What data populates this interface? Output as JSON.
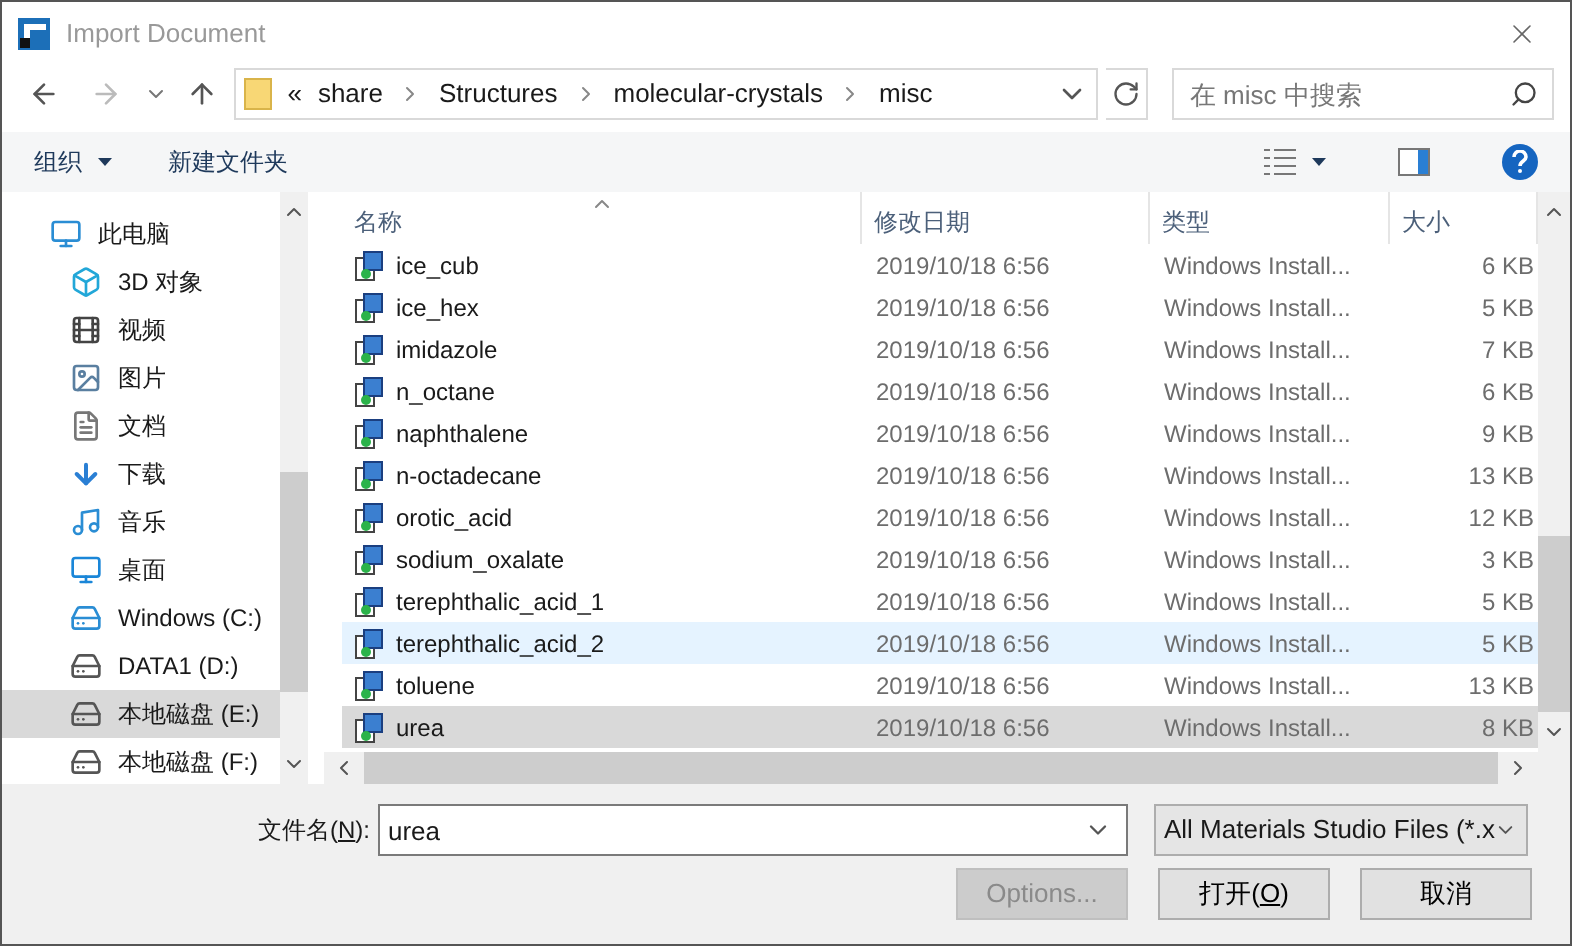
{
  "window": {
    "title": "Import Document"
  },
  "address_bar": {
    "overflow": "«",
    "segments": [
      "share",
      "Structures",
      "molecular-crystals",
      "misc"
    ]
  },
  "search": {
    "placeholder": "在 misc 中搜索"
  },
  "toolbar": {
    "organize": "组织",
    "new_folder": "新建文件夹"
  },
  "sidebar": {
    "items": [
      {
        "label": "此电脑",
        "kind": "computer",
        "selected": false,
        "children": [
          {
            "label": "3D 对象",
            "kind": "cube",
            "selected": false
          },
          {
            "label": "视频",
            "kind": "video",
            "selected": false
          },
          {
            "label": "图片",
            "kind": "pictures",
            "selected": false
          },
          {
            "label": "文档",
            "kind": "document",
            "selected": false
          },
          {
            "label": "下载",
            "kind": "download",
            "selected": false
          },
          {
            "label": "音乐",
            "kind": "music",
            "selected": false
          },
          {
            "label": "桌面",
            "kind": "desktop",
            "selected": false
          },
          {
            "label": "Windows (C:)",
            "kind": "system-drive",
            "selected": false
          },
          {
            "label": "DATA1 (D:)",
            "kind": "drive",
            "selected": false
          },
          {
            "label": "本地磁盘 (E:)",
            "kind": "drive",
            "selected": true
          },
          {
            "label": "本地磁盘 (F:)",
            "kind": "drive",
            "selected": false
          }
        ]
      }
    ]
  },
  "table": {
    "columns": [
      {
        "label": "名称",
        "sorted": true
      },
      {
        "label": "修改日期",
        "sorted": false
      },
      {
        "label": "类型",
        "sorted": false
      },
      {
        "label": "大小",
        "sorted": false
      }
    ],
    "rows": [
      {
        "name": "ice_cub",
        "modified": "2019/10/18 6:56",
        "type": "Windows Install...",
        "size": "6 KB",
        "selected": false,
        "hovered": false
      },
      {
        "name": "ice_hex",
        "modified": "2019/10/18 6:56",
        "type": "Windows Install...",
        "size": "5 KB",
        "selected": false,
        "hovered": false
      },
      {
        "name": "imidazole",
        "modified": "2019/10/18 6:56",
        "type": "Windows Install...",
        "size": "7 KB",
        "selected": false,
        "hovered": false
      },
      {
        "name": "n_octane",
        "modified": "2019/10/18 6:56",
        "type": "Windows Install...",
        "size": "6 KB",
        "selected": false,
        "hovered": false
      },
      {
        "name": "naphthalene",
        "modified": "2019/10/18 6:56",
        "type": "Windows Install...",
        "size": "9 KB",
        "selected": false,
        "hovered": false
      },
      {
        "name": "n-octadecane",
        "modified": "2019/10/18 6:56",
        "type": "Windows Install...",
        "size": "13 KB",
        "selected": false,
        "hovered": false
      },
      {
        "name": "orotic_acid",
        "modified": "2019/10/18 6:56",
        "type": "Windows Install...",
        "size": "12 KB",
        "selected": false,
        "hovered": false
      },
      {
        "name": "sodium_oxalate",
        "modified": "2019/10/18 6:56",
        "type": "Windows Install...",
        "size": "3 KB",
        "selected": false,
        "hovered": false
      },
      {
        "name": "terephthalic_acid_1",
        "modified": "2019/10/18 6:56",
        "type": "Windows Install...",
        "size": "5 KB",
        "selected": false,
        "hovered": false
      },
      {
        "name": "terephthalic_acid_2",
        "modified": "2019/10/18 6:56",
        "type": "Windows Install...",
        "size": "5 KB",
        "selected": false,
        "hovered": true
      },
      {
        "name": "toluene",
        "modified": "2019/10/18 6:56",
        "type": "Windows Install...",
        "size": "13 KB",
        "selected": false,
        "hovered": false
      },
      {
        "name": "urea",
        "modified": "2019/10/18 6:56",
        "type": "Windows Install...",
        "size": "8 KB",
        "selected": true,
        "hovered": false
      }
    ]
  },
  "filename": {
    "label_before": "文件名(",
    "mnemonic": "N",
    "label_after": "):",
    "value": "urea"
  },
  "filetype": {
    "value": "All Materials Studio Files (*.x"
  },
  "buttons": [
    {
      "label_before": "Options...",
      "disabled": true
    },
    {
      "label_before": "打开(",
      "mnemonic": "O",
      "label_after": ")",
      "disabled": false
    },
    {
      "label_before": "取消",
      "disabled": false
    }
  ]
}
